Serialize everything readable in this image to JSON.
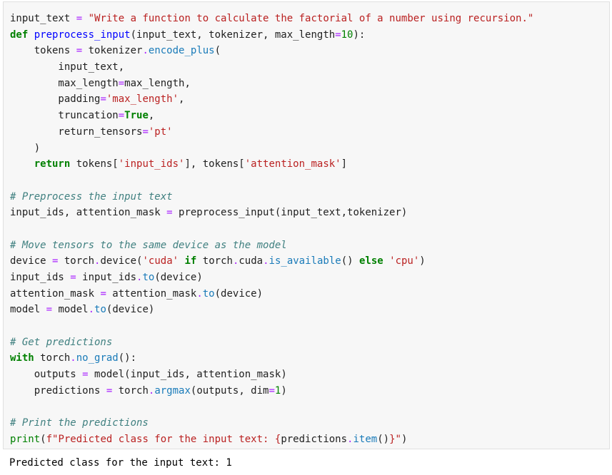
{
  "cell": {
    "lines": [
      [
        {
          "t": "input_text ",
          "c": ""
        },
        {
          "t": "=",
          "c": "op"
        },
        {
          "t": " ",
          "c": ""
        },
        {
          "t": "\"Write a function to calculate the factorial of a number using recursion.\"",
          "c": "str"
        }
      ],
      [
        {
          "t": "def",
          "c": "kw"
        },
        {
          "t": " ",
          "c": ""
        },
        {
          "t": "preprocess_input",
          "c": "fn"
        },
        {
          "t": "(input_text, tokenizer, max_length",
          "c": ""
        },
        {
          "t": "=",
          "c": "op"
        },
        {
          "t": "10",
          "c": "num"
        },
        {
          "t": "):",
          "c": ""
        }
      ],
      [
        {
          "t": "    tokens ",
          "c": ""
        },
        {
          "t": "=",
          "c": "op"
        },
        {
          "t": " tokenizer",
          "c": ""
        },
        {
          "t": ".",
          "c": "op"
        },
        {
          "t": "encode_plus",
          "c": "attr"
        },
        {
          "t": "(",
          "c": ""
        }
      ],
      [
        {
          "t": "        input_text,",
          "c": ""
        }
      ],
      [
        {
          "t": "        max_length",
          "c": ""
        },
        {
          "t": "=",
          "c": "op"
        },
        {
          "t": "max_length,",
          "c": ""
        }
      ],
      [
        {
          "t": "        padding",
          "c": ""
        },
        {
          "t": "=",
          "c": "op"
        },
        {
          "t": "'max_length'",
          "c": "str"
        },
        {
          "t": ",",
          "c": ""
        }
      ],
      [
        {
          "t": "        truncation",
          "c": ""
        },
        {
          "t": "=",
          "c": "op"
        },
        {
          "t": "True",
          "c": "kw"
        },
        {
          "t": ",",
          "c": ""
        }
      ],
      [
        {
          "t": "        return_tensors",
          "c": ""
        },
        {
          "t": "=",
          "c": "op"
        },
        {
          "t": "'pt'",
          "c": "str"
        }
      ],
      [
        {
          "t": "    )",
          "c": ""
        }
      ],
      [
        {
          "t": "    ",
          "c": ""
        },
        {
          "t": "return",
          "c": "kw"
        },
        {
          "t": " tokens[",
          "c": ""
        },
        {
          "t": "'input_ids'",
          "c": "str"
        },
        {
          "t": "], tokens[",
          "c": ""
        },
        {
          "t": "'attention_mask'",
          "c": "str"
        },
        {
          "t": "]",
          "c": ""
        }
      ],
      [],
      [
        {
          "t": "# Preprocess the input text",
          "c": "com"
        }
      ],
      [
        {
          "t": "input_ids, attention_mask ",
          "c": ""
        },
        {
          "t": "=",
          "c": "op"
        },
        {
          "t": " preprocess_input(input_text,tokenizer)",
          "c": ""
        }
      ],
      [],
      [
        {
          "t": "# Move tensors to the same device as the model",
          "c": "com"
        }
      ],
      [
        {
          "t": "device ",
          "c": ""
        },
        {
          "t": "=",
          "c": "op"
        },
        {
          "t": " torch",
          "c": ""
        },
        {
          "t": ".",
          "c": "op"
        },
        {
          "t": "device(",
          "c": ""
        },
        {
          "t": "'cuda'",
          "c": "str"
        },
        {
          "t": " ",
          "c": ""
        },
        {
          "t": "if",
          "c": "kw"
        },
        {
          "t": " torch",
          "c": ""
        },
        {
          "t": ".",
          "c": "op"
        },
        {
          "t": "cuda",
          "c": ""
        },
        {
          "t": ".",
          "c": "op"
        },
        {
          "t": "is_available",
          "c": "attr"
        },
        {
          "t": "() ",
          "c": ""
        },
        {
          "t": "else",
          "c": "kw"
        },
        {
          "t": " ",
          "c": ""
        },
        {
          "t": "'cpu'",
          "c": "str"
        },
        {
          "t": ")",
          "c": ""
        }
      ],
      [
        {
          "t": "input_ids ",
          "c": ""
        },
        {
          "t": "=",
          "c": "op"
        },
        {
          "t": " input_ids",
          "c": ""
        },
        {
          "t": ".",
          "c": "op"
        },
        {
          "t": "to",
          "c": "attr"
        },
        {
          "t": "(device)",
          "c": ""
        }
      ],
      [
        {
          "t": "attention_mask ",
          "c": ""
        },
        {
          "t": "=",
          "c": "op"
        },
        {
          "t": " attention_mask",
          "c": ""
        },
        {
          "t": ".",
          "c": "op"
        },
        {
          "t": "to",
          "c": "attr"
        },
        {
          "t": "(device)",
          "c": ""
        }
      ],
      [
        {
          "t": "model ",
          "c": ""
        },
        {
          "t": "=",
          "c": "op"
        },
        {
          "t": " model",
          "c": ""
        },
        {
          "t": ".",
          "c": "op"
        },
        {
          "t": "to",
          "c": "attr"
        },
        {
          "t": "(device)",
          "c": ""
        }
      ],
      [],
      [
        {
          "t": "# Get predictions",
          "c": "com"
        }
      ],
      [
        {
          "t": "with",
          "c": "kw"
        },
        {
          "t": " torch",
          "c": ""
        },
        {
          "t": ".",
          "c": "op"
        },
        {
          "t": "no_grad",
          "c": "attr"
        },
        {
          "t": "():",
          "c": ""
        }
      ],
      [
        {
          "t": "    outputs ",
          "c": ""
        },
        {
          "t": "=",
          "c": "op"
        },
        {
          "t": " model(input_ids, attention_mask)",
          "c": ""
        }
      ],
      [
        {
          "t": "    predictions ",
          "c": ""
        },
        {
          "t": "=",
          "c": "op"
        },
        {
          "t": " torch",
          "c": ""
        },
        {
          "t": ".",
          "c": "op"
        },
        {
          "t": "argmax",
          "c": "attr"
        },
        {
          "t": "(outputs, dim",
          "c": ""
        },
        {
          "t": "=",
          "c": "op"
        },
        {
          "t": "1",
          "c": "num"
        },
        {
          "t": ")",
          "c": ""
        }
      ],
      [],
      [
        {
          "t": "# Print the predictions",
          "c": "com"
        }
      ],
      [
        {
          "t": "print",
          "c": "bi"
        },
        {
          "t": "(",
          "c": ""
        },
        {
          "t": "f\"Predicted class for the input text: ",
          "c": "str"
        },
        {
          "t": "{",
          "c": "str"
        },
        {
          "t": "predictions",
          "c": ""
        },
        {
          "t": ".",
          "c": "op"
        },
        {
          "t": "item",
          "c": "attr"
        },
        {
          "t": "()",
          "c": ""
        },
        {
          "t": "}",
          "c": "str"
        },
        {
          "t": "\"",
          "c": "str"
        },
        {
          "t": ")",
          "c": ""
        }
      ]
    ]
  },
  "output": {
    "text": "Predicted class for the input text: 1"
  },
  "colors": {
    "cell_background": "#f7f7f7",
    "keyword": "#008000",
    "string": "#ba2121",
    "comment": "#408080",
    "operator": "#aa22ff",
    "function_name": "#0000ff"
  }
}
